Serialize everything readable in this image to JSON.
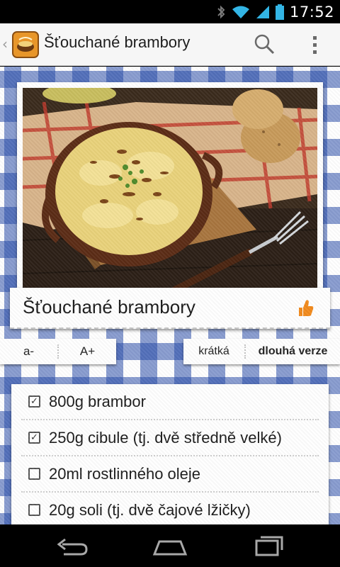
{
  "status_bar": {
    "time": "17:52",
    "icons": [
      "bluetooth-icon",
      "wifi-icon",
      "signal-icon",
      "battery-icon"
    ]
  },
  "action_bar": {
    "title": "Šťouchané brambory",
    "icons": [
      "up-chevron-icon",
      "app-logo-icon",
      "search-icon",
      "overflow-menu-icon"
    ]
  },
  "recipe": {
    "title": "Šťouchané brambory",
    "like_icon": "thumbs-up-icon"
  },
  "font_controls": {
    "decrease_label": "a-",
    "increase_label": "A+"
  },
  "version_toggle": {
    "short_label": "krátká",
    "long_label": "dlouhá verze",
    "selected": "dlouhá verze"
  },
  "ingredients": [
    {
      "text": "800g brambor",
      "checked": true
    },
    {
      "text": "250g cibule (tj. dvě středně velké)",
      "checked": true
    },
    {
      "text": "20ml rostlinného oleje",
      "checked": false
    },
    {
      "text": "20g soli (tj. dvě čajové lžičky)",
      "checked": false
    }
  ],
  "colors": {
    "tablecloth_blue": "#264aa8",
    "accent_orange": "#f28a1c",
    "action_bar_bg": "#f6f6f6"
  },
  "nav_bar": {
    "icons": [
      "back-icon",
      "home-icon",
      "recent-apps-icon"
    ]
  }
}
